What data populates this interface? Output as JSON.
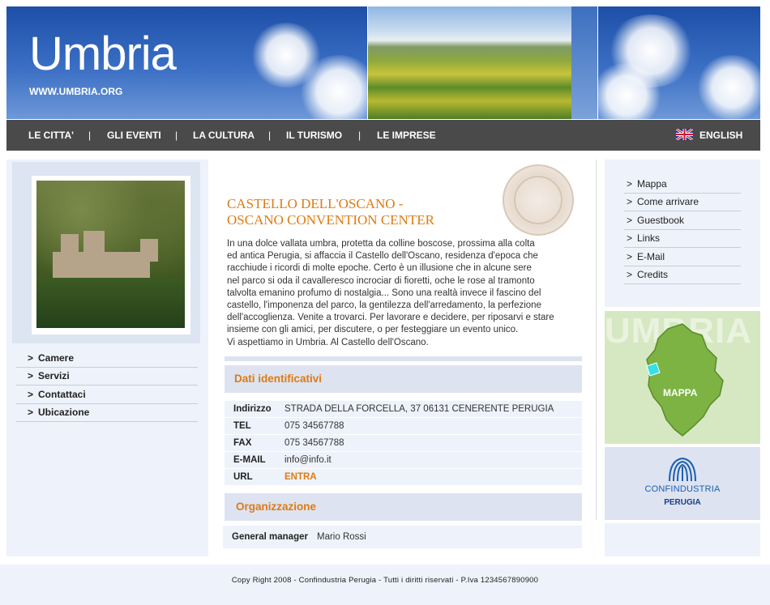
{
  "header": {
    "site_title": "Umbria",
    "site_url": "WWW.UMBRIA.ORG"
  },
  "nav": {
    "items": [
      {
        "label": "LE CITTA'"
      },
      {
        "label": "GLI EVENTI"
      },
      {
        "label": "LA CULTURA"
      },
      {
        "label": "IL TURISMO"
      },
      {
        "label": "LE IMPRESE"
      }
    ],
    "separator": "|",
    "language": "ENGLISH"
  },
  "left_menu": {
    "items": [
      {
        "chevron": ">",
        "label": "Camere"
      },
      {
        "chevron": ">",
        "label": "Servizi"
      },
      {
        "chevron": ">",
        "label": "Contattaci"
      },
      {
        "chevron": ">",
        "label": "Ubicazione"
      }
    ]
  },
  "main": {
    "title_line1": "CASTELLO DELL'OSCANO -",
    "title_line2": "OSCANO CONVENTION CENTER",
    "description_lines": [
      "In una dolce vallata umbra, protetta da colline boscose, prossima alla colta",
      "ed antica Perugia, si affaccia il Castello dell'Oscano, residenza d'epoca che",
      "racchiude i ricordi di molte epoche. Certo è un illusione che in alcune sere",
      "nel parco si oda il cavalleresco incrociar di fioretti, oche le rose al tramonto",
      "talvolta emanino profumo di nostalgia... Sono una realtà invece il fascino del",
      "castello, l'imponenza del parco, la gentilezza dell'arredamento, la perfezione",
      "dell'accoglienza. Venite a trovarci. Per lavorare e decidere, per riposarvi e stare",
      "insieme con gli amici, per discutere, o per festeggiare un evento unico.",
      "Vi aspettiamo in Umbria. Al Castello dell'Oscano."
    ],
    "identity_header": "Dati identificativi",
    "identity_rows": [
      {
        "key": "Indirizzo",
        "value": "STRADA DELLA FORCELLA, 37  06131 CENERENTE  PERUGIA"
      },
      {
        "key": "TEL",
        "value": "075 34567788"
      },
      {
        "key": "FAX",
        "value": "075 34567788"
      },
      {
        "key": "E-MAIL",
        "value": "info@info.it"
      },
      {
        "key": "URL",
        "value": "ENTRA"
      }
    ],
    "org_header": "Organizzazione",
    "org_row": {
      "key": "General manager",
      "value": "Mario Rossi"
    }
  },
  "right_menu": {
    "items": [
      {
        "chevron": ">",
        "label": "Mappa"
      },
      {
        "chevron": ">",
        "label": "Come arrivare"
      },
      {
        "chevron": ">",
        "label": "Guestbook"
      },
      {
        "chevron": ">",
        "label": "Links"
      },
      {
        "chevron": ">",
        "label": "E-Mail"
      },
      {
        "chevron": ">",
        "label": "Credits"
      }
    ]
  },
  "map": {
    "watermark": "UMBRIA",
    "label": "MAPPA"
  },
  "sponsor": {
    "name": "CONFINDUSTRIA",
    "city": "PERUGIA"
  },
  "footer": {
    "text": "Copy Right 2008 - Confindustria Perugia - Tutti i diritti riservati - P.Iva 1234567890900"
  },
  "colors": {
    "accent_orange": "#e07a10",
    "nav_bg": "#4a4a4a",
    "panel_bg": "#eef2fa",
    "header_blue": "#1d4fa8"
  }
}
